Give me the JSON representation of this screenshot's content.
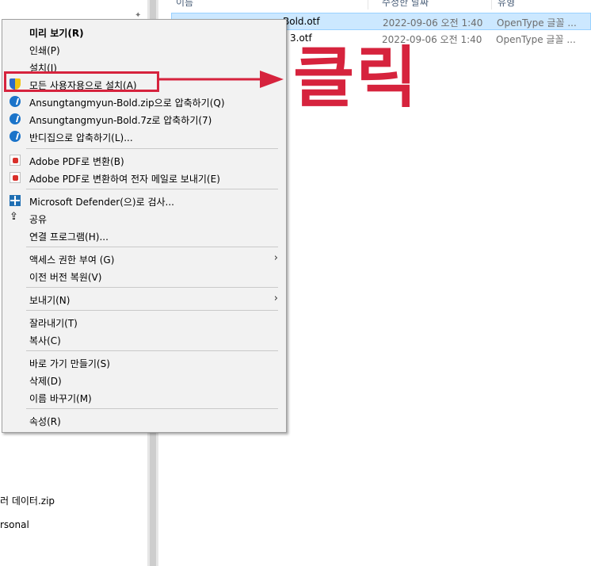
{
  "nav": {
    "items": [
      {
        "label": "러 데이터.zip"
      },
      {
        "label": "rsonal"
      }
    ]
  },
  "file_list": {
    "headers": {
      "name": "이름",
      "date": "수정한 날짜",
      "type": "유형"
    },
    "rows": [
      {
        "name": "Bold.otf",
        "date": "2022-09-06 오전 1:40",
        "type": "OpenType 글꼴 ...",
        "selected": true
      },
      {
        "name": "3.otf",
        "date": "2022-09-06 오전 1:40",
        "type": "OpenType 글꼴 ...",
        "selected": false
      }
    ]
  },
  "context_menu": {
    "items": [
      {
        "label": "미리 보기(R)",
        "bold": true
      },
      {
        "label": "인쇄(P)"
      },
      {
        "label": "설치(I)"
      },
      {
        "label": "모든 사용자용으로 설치(A)",
        "icon": "uac-shield-icon"
      },
      {
        "label": "Ansungtangmyun-Bold.zip으로 압축하기(Q)",
        "icon": "bandizip-icon"
      },
      {
        "label": "Ansungtangmyun-Bold.7z로 압축하기(7)",
        "icon": "bandizip-icon"
      },
      {
        "label": "반디집으로 압축하기(L)...",
        "icon": "bandizip-icon"
      },
      {
        "label": "Adobe PDF로 변환(B)",
        "icon": "pdf-icon"
      },
      {
        "label": "Adobe PDF로 변환하여 전자 메일로 보내기(E)",
        "icon": "pdf-mail-icon"
      },
      {
        "label": "Microsoft Defender(으)로 검사...",
        "icon": "defender-icon"
      },
      {
        "label": "공유",
        "icon": "share-icon"
      },
      {
        "label": "연결 프로그램(H)..."
      },
      {
        "label": "액세스 권한 부여 (G)",
        "submenu": true
      },
      {
        "label": "이전 버전 복원(V)"
      },
      {
        "label": "보내기(N)",
        "submenu": true
      },
      {
        "label": "잘라내기(T)"
      },
      {
        "label": "복사(C)"
      },
      {
        "label": "바로 가기 만들기(S)"
      },
      {
        "label": "삭제(D)"
      },
      {
        "label": "이름 바꾸기(M)"
      },
      {
        "label": "속성(R)"
      }
    ]
  },
  "annotation": {
    "text": "클릭",
    "color": "#d6233d"
  }
}
